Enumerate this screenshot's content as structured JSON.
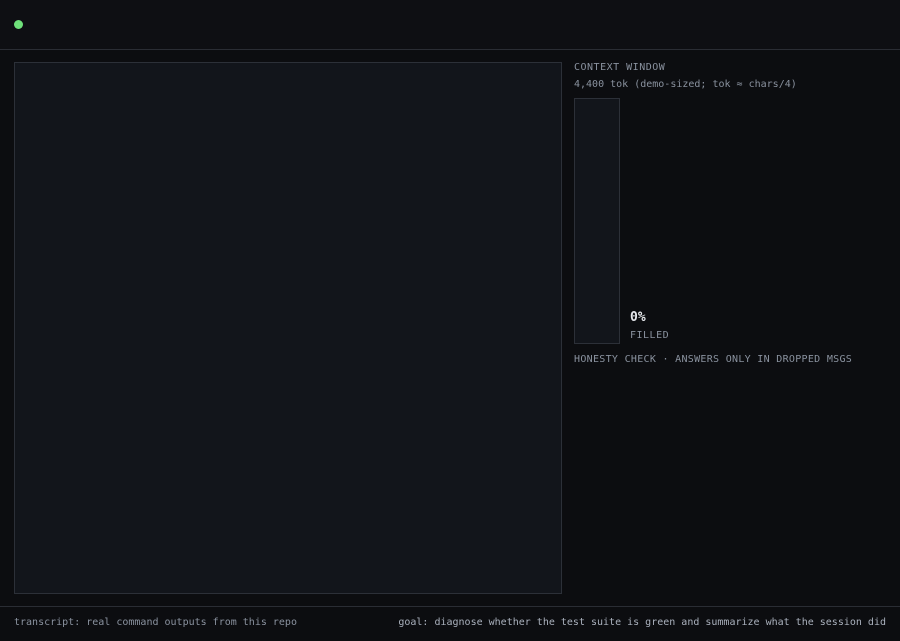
{
  "header": {
    "status_color": "#6ee07a"
  },
  "context_window": {
    "title": "CONTEXT WINDOW",
    "subtitle": "4,400 tok (demo-sized; tok ≈ chars/4)",
    "fill_percent_value": 0,
    "fill_percent": "0%",
    "filled_label": "FILLED",
    "fill_color": "#6ee07a"
  },
  "honesty_check": {
    "label": "HONESTY CHECK · ANSWERS ONLY IN DROPPED MSGS"
  },
  "footer": {
    "transcript": "transcript: real command outputs from this repo",
    "goal": "goal: diagnose whether the test suite is green and summarize what the session did"
  }
}
